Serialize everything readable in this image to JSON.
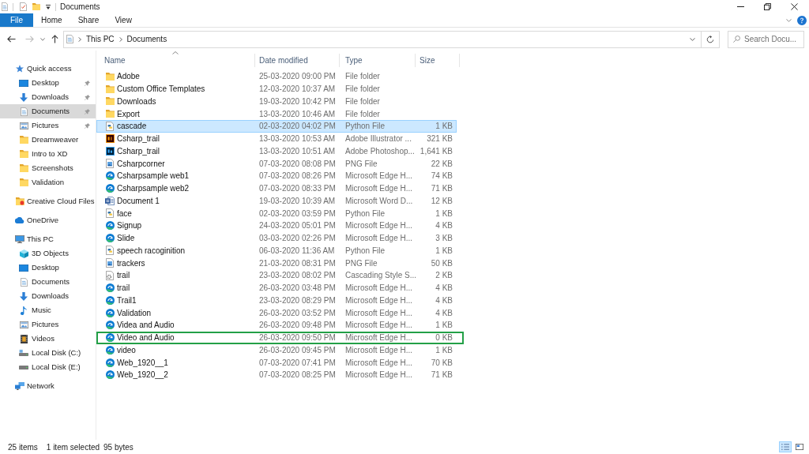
{
  "window": {
    "title": "Documents"
  },
  "ribbon": {
    "tabs": [
      {
        "label": "File",
        "kind": "menu",
        "selected": false
      },
      {
        "label": "Home",
        "kind": "tab",
        "selected": false
      },
      {
        "label": "Share",
        "kind": "tab",
        "selected": false
      },
      {
        "label": "View",
        "kind": "tab",
        "selected": false
      }
    ]
  },
  "address_bar": {
    "path": [
      "This PC",
      "Documents"
    ]
  },
  "search": {
    "placeholder": "Search Docu..."
  },
  "sidebar": {
    "items": [
      {
        "label": "Quick access",
        "kind": "star",
        "selected": false,
        "children": [
          {
            "label": "Desktop",
            "kind": "desktop",
            "pinned": true,
            "selected": false
          },
          {
            "label": "Downloads",
            "kind": "download",
            "pinned": true,
            "selected": false
          },
          {
            "label": "Documents",
            "kind": "document",
            "pinned": true,
            "selected": true
          },
          {
            "label": "Pictures",
            "kind": "picture",
            "pinned": true,
            "selected": false
          },
          {
            "label": "Dreamweaver",
            "kind": "folder",
            "pinned": false,
            "selected": false
          },
          {
            "label": "Intro to XD",
            "kind": "folder",
            "pinned": false,
            "selected": false
          },
          {
            "label": "Screenshots",
            "kind": "folder",
            "pinned": false,
            "selected": false
          },
          {
            "label": "Validation",
            "kind": "folder",
            "pinned": false,
            "selected": false
          }
        ]
      },
      {
        "label": "Creative Cloud Files",
        "kind": "creative_cloud",
        "selected": false
      },
      {
        "label": "OneDrive",
        "kind": "cloud",
        "selected": false
      },
      {
        "label": "This PC",
        "kind": "computer",
        "selected": false,
        "children": [
          {
            "label": "3D Objects",
            "kind": "cube",
            "selected": false
          },
          {
            "label": "Desktop",
            "kind": "desktop",
            "selected": false
          },
          {
            "label": "Documents",
            "kind": "document",
            "selected": false
          },
          {
            "label": "Downloads",
            "kind": "download",
            "selected": false
          },
          {
            "label": "Music",
            "kind": "music",
            "selected": false
          },
          {
            "label": "Pictures",
            "kind": "picture",
            "selected": false
          },
          {
            "label": "Videos",
            "kind": "video",
            "selected": false
          },
          {
            "label": "Local Disk (C:)",
            "kind": "system_drive",
            "selected": false
          },
          {
            "label": "Local Disk (E:)",
            "kind": "drive",
            "selected": false
          }
        ]
      },
      {
        "label": "Network",
        "kind": "network",
        "selected": false
      }
    ]
  },
  "columns": [
    {
      "label": "Name",
      "sorted": true
    },
    {
      "label": "Date modified",
      "sorted": false
    },
    {
      "label": "Type",
      "sorted": false
    },
    {
      "label": "Size",
      "sorted": false
    }
  ],
  "files": [
    {
      "name": "Adobe",
      "date": "25-03-2020 09:00 PM",
      "type": "File folder",
      "kind": "folder",
      "selected": false,
      "highlighted": false
    },
    {
      "name": "Custom Office Templates",
      "date": "12-03-2020 10:37 AM",
      "type": "File folder",
      "kind": "folder",
      "selected": false,
      "highlighted": false
    },
    {
      "name": "Downloads",
      "date": "19-03-2020 10:42 PM",
      "type": "File folder",
      "kind": "folder",
      "selected": false,
      "highlighted": false
    },
    {
      "name": "Export",
      "date": "13-03-2020 10:46 AM",
      "type": "File folder",
      "kind": "folder",
      "selected": false,
      "highlighted": false
    },
    {
      "name": "cascade",
      "date": "02-03-2020 04:02 PM",
      "type": "Python File",
      "size": "1 KB",
      "kind": "python",
      "selected": true,
      "highlighted": false
    },
    {
      "name": "Csharp_trail",
      "date": "13-03-2020 10:53 AM",
      "type": "Adobe Illustrator ...",
      "size": "321 KB",
      "kind": "illustrator",
      "selected": false,
      "highlighted": false
    },
    {
      "name": "Csharp_trail",
      "date": "13-03-2020 10:51 AM",
      "type": "Adobe Photoshop...",
      "size": "1,641 KB",
      "kind": "photoshop",
      "selected": false,
      "highlighted": false
    },
    {
      "name": "Csharpcorner",
      "date": "07-03-2020 08:08 PM",
      "type": "PNG File",
      "size": "22 KB",
      "kind": "png",
      "selected": false,
      "highlighted": false
    },
    {
      "name": "Csharpsample web1",
      "date": "07-03-2020 08:26 PM",
      "type": "Microsoft Edge H...",
      "size": "74 KB",
      "kind": "edge",
      "selected": false,
      "highlighted": false
    },
    {
      "name": "Csharpsample web2",
      "date": "07-03-2020 08:33 PM",
      "type": "Microsoft Edge H...",
      "size": "71 KB",
      "kind": "edge",
      "selected": false,
      "highlighted": false
    },
    {
      "name": "Document 1",
      "date": "19-03-2020 10:39 AM",
      "type": "Microsoft Word D...",
      "size": "12 KB",
      "kind": "word",
      "selected": false,
      "highlighted": false
    },
    {
      "name": "face",
      "date": "02-03-2020 03:59 PM",
      "type": "Python File",
      "size": "1 KB",
      "kind": "python",
      "selected": false,
      "highlighted": false
    },
    {
      "name": "Signup",
      "date": "24-03-2020 05:01 PM",
      "type": "Microsoft Edge H...",
      "size": "4 KB",
      "kind": "edge",
      "selected": false,
      "highlighted": false
    },
    {
      "name": "Slide",
      "date": "03-03-2020 02:26 PM",
      "type": "Microsoft Edge H...",
      "size": "3 KB",
      "kind": "edge",
      "selected": false,
      "highlighted": false
    },
    {
      "name": "speech racoginition",
      "date": "06-03-2020 11:36 AM",
      "type": "Python File",
      "size": "1 KB",
      "kind": "python",
      "selected": false,
      "highlighted": false
    },
    {
      "name": "trackers",
      "date": "21-03-2020 08:31 PM",
      "type": "PNG File",
      "size": "50 KB",
      "kind": "png",
      "selected": false,
      "highlighted": false
    },
    {
      "name": "trail",
      "date": "23-03-2020 08:02 PM",
      "type": "Cascading Style S...",
      "size": "2 KB",
      "kind": "css",
      "selected": false,
      "highlighted": false
    },
    {
      "name": "trail",
      "date": "26-03-2020 03:48 PM",
      "type": "Microsoft Edge H...",
      "size": "4 KB",
      "kind": "edge",
      "selected": false,
      "highlighted": false
    },
    {
      "name": "Trail1",
      "date": "23-03-2020 08:29 PM",
      "type": "Microsoft Edge H...",
      "size": "4 KB",
      "kind": "edge",
      "selected": false,
      "highlighted": false
    },
    {
      "name": "Validation",
      "date": "26-03-2020 03:52 PM",
      "type": "Microsoft Edge H...",
      "size": "4 KB",
      "kind": "edge",
      "selected": false,
      "highlighted": false
    },
    {
      "name": "Videa and Audio",
      "date": "26-03-2020 09:48 PM",
      "type": "Microsoft Edge H...",
      "size": "1 KB",
      "kind": "edge",
      "selected": false,
      "highlighted": false
    },
    {
      "name": "Video and Audio",
      "date": "26-03-2020 09:50 PM",
      "type": "Microsoft Edge H...",
      "size": "0 KB",
      "kind": "edge",
      "selected": false,
      "highlighted": true
    },
    {
      "name": "video",
      "date": "26-03-2020 09:45 PM",
      "type": "Microsoft Edge H...",
      "size": "1 KB",
      "kind": "edge",
      "selected": false,
      "highlighted": false
    },
    {
      "name": "Web_1920__1",
      "date": "07-03-2020 07:41 PM",
      "type": "Microsoft Edge H...",
      "size": "70 KB",
      "kind": "edge",
      "selected": false,
      "highlighted": false
    },
    {
      "name": "Web_1920__2",
      "date": "07-03-2020 08:25 PM",
      "type": "Microsoft Edge H...",
      "size": "71 KB",
      "kind": "edge",
      "selected": false,
      "highlighted": false
    }
  ],
  "status_bar": {
    "item_count": "25 items",
    "selection": "1 item selected",
    "selection_size": "95 bytes",
    "views": [
      {
        "kind": "details",
        "selected": true
      },
      {
        "kind": "large_icons",
        "selected": false
      }
    ]
  }
}
